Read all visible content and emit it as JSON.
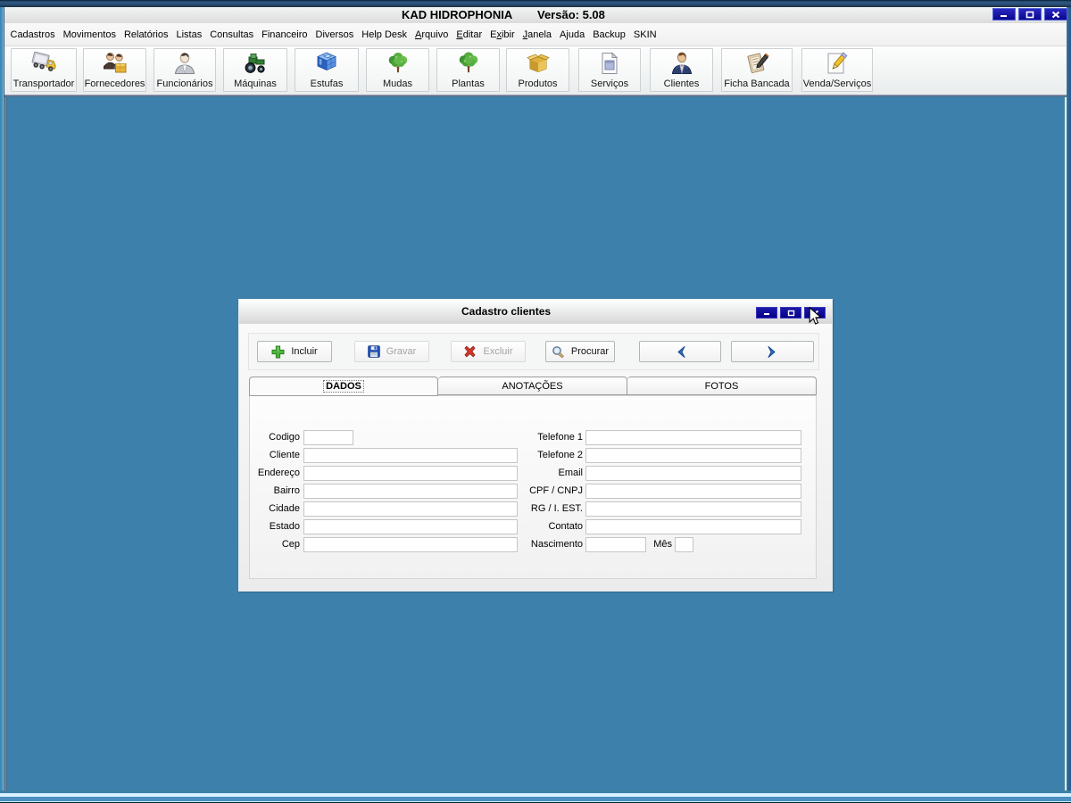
{
  "titlebar": {
    "app_title": "KAD HIDROPHONIA",
    "version": "Versão: 5.08"
  },
  "menu": {
    "items": [
      {
        "label": "Cadastros"
      },
      {
        "label": "Movimentos"
      },
      {
        "label": "Relatórios"
      },
      {
        "label": "Listas"
      },
      {
        "label": "Consultas"
      },
      {
        "label": "Financeiro"
      },
      {
        "label": "Diversos"
      },
      {
        "label": "Help Desk"
      },
      {
        "label": "Arquivo",
        "underline": "A"
      },
      {
        "label": "Editar",
        "underline": "E"
      },
      {
        "label": "Exibir",
        "underline": "x"
      },
      {
        "label": "Janela",
        "underline": "J"
      },
      {
        "label": "Ajuda"
      },
      {
        "label": "Backup"
      },
      {
        "label": "SKIN"
      }
    ]
  },
  "toolbar": {
    "buttons": [
      {
        "label": "Transportador",
        "icon": "truck-icon"
      },
      {
        "label": "Fornecedores",
        "icon": "suppliers-icon"
      },
      {
        "label": "Funcionários",
        "icon": "employee-icon"
      },
      {
        "label": "Máquinas",
        "icon": "tractor-icon"
      },
      {
        "label": "Estufas",
        "icon": "greenhouse-icon"
      },
      {
        "label": "Mudas",
        "icon": "seedling-icon"
      },
      {
        "label": "Plantas",
        "icon": "plant-icon"
      },
      {
        "label": "Produtos",
        "icon": "products-icon"
      },
      {
        "label": "Serviços",
        "icon": "services-icon"
      },
      {
        "label": "Clientes",
        "icon": "client-icon"
      },
      {
        "label": "Ficha Bancada",
        "icon": "worksheet-icon"
      },
      {
        "label": "Venda/Serviços",
        "icon": "sale-icon"
      }
    ]
  },
  "dialog": {
    "title": "Cadastro clientes",
    "toolbar": {
      "buttons": [
        {
          "label": "Incluir",
          "icon": "plus-icon",
          "disabled": false
        },
        {
          "label": "Gravar",
          "icon": "save-icon",
          "disabled": true
        },
        {
          "label": "Excluir",
          "icon": "delete-icon",
          "disabled": true
        },
        {
          "label": "Procurar",
          "icon": "search-icon",
          "disabled": false
        }
      ]
    },
    "tabs": [
      {
        "label": "DADOS",
        "active": true
      },
      {
        "label": "ANOTAÇÕES",
        "active": false
      },
      {
        "label": "FOTOS",
        "active": false
      }
    ],
    "form": {
      "left_fields": [
        {
          "label": "Codigo",
          "value": ""
        },
        {
          "label": "Cliente",
          "value": ""
        },
        {
          "label": "Endereço",
          "value": ""
        },
        {
          "label": "Bairro",
          "value": ""
        },
        {
          "label": "Cidade",
          "value": ""
        },
        {
          "label": "Estado",
          "value": ""
        },
        {
          "label": "Cep",
          "value": ""
        }
      ],
      "right_fields": [
        {
          "label": "Telefone 1",
          "value": ""
        },
        {
          "label": "Telefone 2",
          "value": ""
        },
        {
          "label": "Email",
          "value": ""
        },
        {
          "label": "CPF / CNPJ",
          "value": ""
        },
        {
          "label": "RG / I. EST.",
          "value": ""
        },
        {
          "label": "Contato",
          "value": ""
        },
        {
          "label": "Nascimento",
          "value": ""
        }
      ],
      "mes_label": "Mês",
      "mes_value": ""
    }
  }
}
